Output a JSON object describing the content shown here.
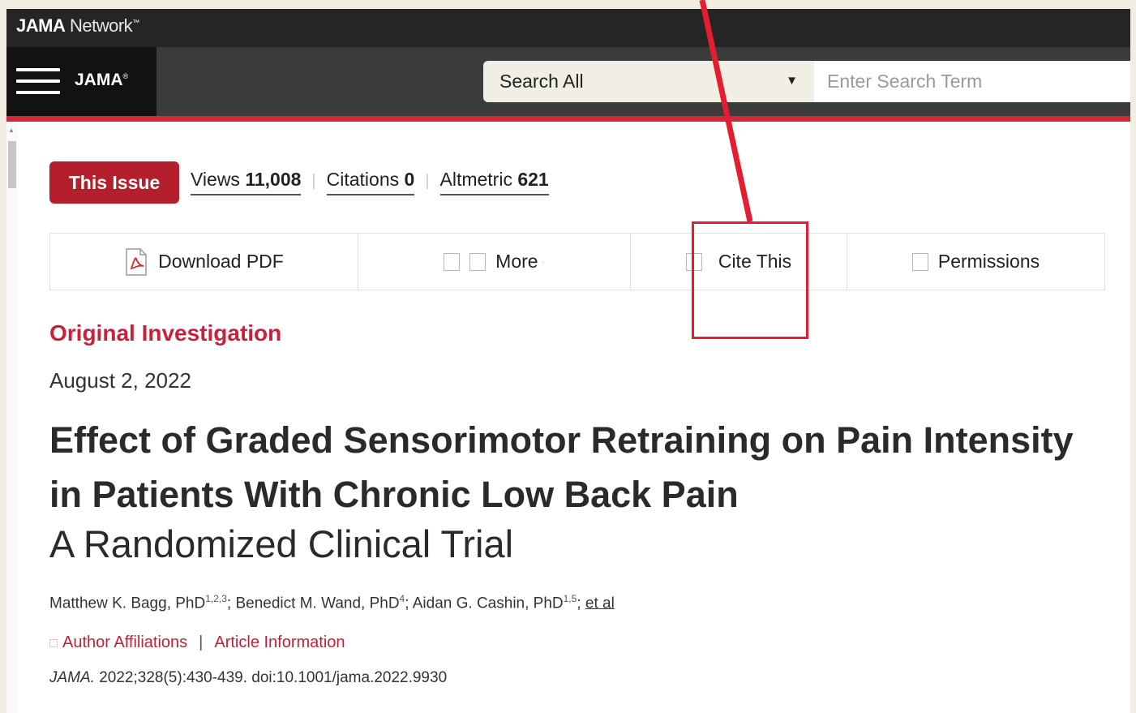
{
  "network": {
    "brand_bold": "JAMA",
    "brand_light": "Network",
    "brand_mark": "™"
  },
  "journal": {
    "name": "JAMA",
    "reg_mark": "®"
  },
  "search": {
    "scope": "Search All",
    "arrow": "▼",
    "placeholder": "Enter Search Term"
  },
  "issue": {
    "badge": "This Issue",
    "metrics": [
      {
        "label": "Views",
        "value": "11,008"
      },
      {
        "label": "Citations",
        "value": "0"
      },
      {
        "label": "Altmetric",
        "value": "621"
      }
    ]
  },
  "toolbar": {
    "download_pdf": "Download PDF",
    "more": "More",
    "cite_this": "Cite This",
    "permissions": "Permissions"
  },
  "article": {
    "type": "Original Investigation",
    "date": "August 2, 2022",
    "title": "Effect of Graded Sensorimotor Retraining on Pain Intensity in Patients With Chronic Low Back Pain",
    "subtitle": "A Randomized Clinical Trial",
    "authors": [
      {
        "name": "Matthew K. Bagg, PhD",
        "sup": "1,2,3"
      },
      {
        "name": "Benedict M. Wand, PhD",
        "sup": "4"
      },
      {
        "name": "Aidan G. Cashin, PhD",
        "sup": "1,5"
      }
    ],
    "et_al": "et al",
    "links": {
      "affiliations": "Author Affiliations",
      "separator": "|",
      "info": "Article Information"
    },
    "citation": {
      "journal": "JAMA.",
      "ref": "2022;328(5):430-439. doi:10.1001/jama.2022.9930"
    }
  },
  "annotation": {
    "color": "#e41e30"
  },
  "colors": {
    "accent": "#b41f2e",
    "link": "#c41f36",
    "header": "#252525"
  }
}
